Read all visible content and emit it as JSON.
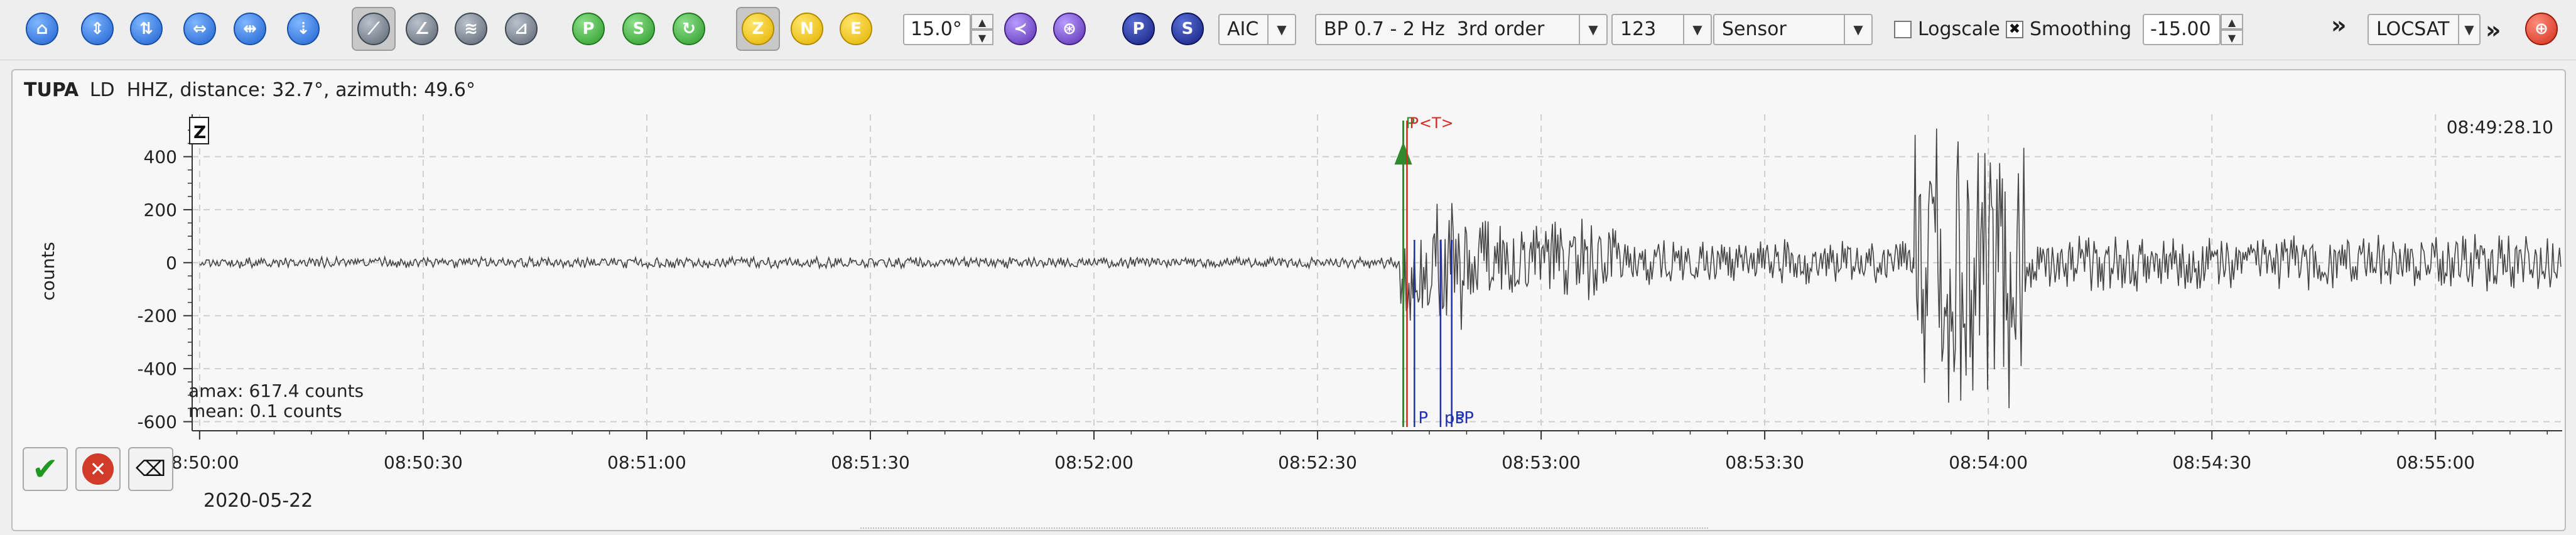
{
  "toolbar": {
    "distance_filter": "15.0°",
    "picker_method": "AIC",
    "filter_name": "BP 0.7 - 2 Hz  3rd order",
    "component_group": "123",
    "unit_mode": "Sensor",
    "logscale_label": "Logscale",
    "logscale_checked": false,
    "smoothing_label": "Smoothing",
    "smoothing_checked": true,
    "amplitude_offset": "-15.00",
    "more_label": "»",
    "locator": "LOCSAT",
    "more_label_2": "»",
    "buttons": {
      "z_label": "Z",
      "n_label": "N",
      "e_label": "E",
      "p_label": "P",
      "s_label": "S"
    }
  },
  "trace": {
    "station": "TUPA",
    "network_channel": "LD  HHZ, distance: 32.7°, azimuth: 49.6°",
    "component_tag": "Z",
    "start_time_label": "08:49:28.10",
    "amax_label": "amax: 617.4 counts",
    "mean_label": "mean: 0.1 counts",
    "y_axis_label": "counts",
    "date_label": "2020-05-22"
  },
  "chart_data": {
    "type": "line",
    "title": "",
    "xlabel": "",
    "ylabel": "counts",
    "ylim": [
      -620,
      560
    ],
    "yticks": [
      400,
      200,
      0,
      -200,
      -400,
      -600
    ],
    "xlim": [
      "08:49:59",
      "08:55:17"
    ],
    "xticks": [
      "08:50:00",
      "08:50:30",
      "08:51:00",
      "08:51:30",
      "08:52:00",
      "08:52:30",
      "08:53:00",
      "08:53:30",
      "08:54:00",
      "08:54:30",
      "08:55:00"
    ],
    "grid": true,
    "picks": [
      {
        "label": "P",
        "time": "08:52:41.5",
        "color": "#2e8b2e",
        "kind": "manual"
      },
      {
        "label": "P",
        "time": "08:52:42.0",
        "color": "#d9281d",
        "kind": "theoretical"
      },
      {
        "label": "P",
        "time": "08:52:43.0",
        "color": "#2030b0",
        "kind": "automatic"
      },
      {
        "label": "<T>",
        "time": "08:52:43.3",
        "color": "#d9281d",
        "kind": "theoretical"
      },
      {
        "label": "pP",
        "time": "08:52:46.5",
        "color": "#2030b0",
        "kind": "automatic"
      },
      {
        "label": "sP",
        "time": "08:52:48.0",
        "color": "#2030b0",
        "kind": "automatic"
      }
    ],
    "series": [
      {
        "name": "",
        "color": "#444444",
        "segments": [
          {
            "from": "08:50:00",
            "to": "08:52:41",
            "amplitude": 22
          },
          {
            "from": "08:52:41",
            "to": "08:52:50",
            "amplitude": 260
          },
          {
            "from": "08:52:50",
            "to": "08:53:10",
            "amplitude": 180
          },
          {
            "from": "08:53:10",
            "to": "08:53:50",
            "amplitude": 90
          },
          {
            "from": "08:53:50",
            "to": "08:54:05",
            "amplitude": 560
          },
          {
            "from": "08:54:05",
            "to": "08:55:17",
            "amplitude": 110
          }
        ]
      }
    ]
  }
}
